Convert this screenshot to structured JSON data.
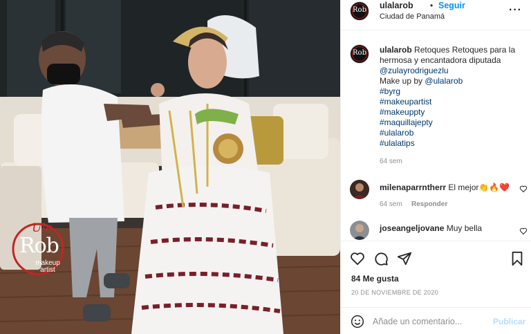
{
  "post": {
    "username": "ulalarob",
    "dot": "•",
    "follow_label": "Seguir",
    "location": "Ciudad de Panamá",
    "more_label": "···",
    "avatar_text": "Rob"
  },
  "watermark": {
    "script": "Ula",
    "main": "Rob",
    "sub": "makeup artist"
  },
  "caption": {
    "username": "ulalarob",
    "text": "Retoques Retoques para la hermosa y encantadora diputada",
    "mention": "@zulayrodriguezlu",
    "makeup_text": "Make up by",
    "makeup_mention": "@ulalarob",
    "hashtags": [
      "#byrg",
      "#makeupartist",
      "#makeuppty",
      "#maquillajepty",
      "#ulalarob",
      "#ulalatips"
    ],
    "time": "64 sem"
  },
  "comments": [
    {
      "username": "milenaparrntherr",
      "text": "El mejor👏🔥❤️",
      "time": "64 sem",
      "reply_label": "Responder"
    },
    {
      "username": "joseangeljovane",
      "text": "Muy bella"
    }
  ],
  "icons": {
    "like": "heart-icon",
    "comment": "comment-icon",
    "share": "share-icon",
    "save": "bookmark-icon",
    "emoji": "emoji-icon",
    "more": "more-icon"
  },
  "engagement": {
    "likes": "84 Me gusta",
    "date": "20 DE NOVIEMBRE DE 2020"
  },
  "add_comment": {
    "placeholder": "Añade un comentario...",
    "publish_label": "Publicar"
  },
  "colors": {
    "link_blue": "#0095f6",
    "mention_navy": "#00376b",
    "publish_disabled": "#b2dffc",
    "secondary_text": "#8e8e8e"
  }
}
